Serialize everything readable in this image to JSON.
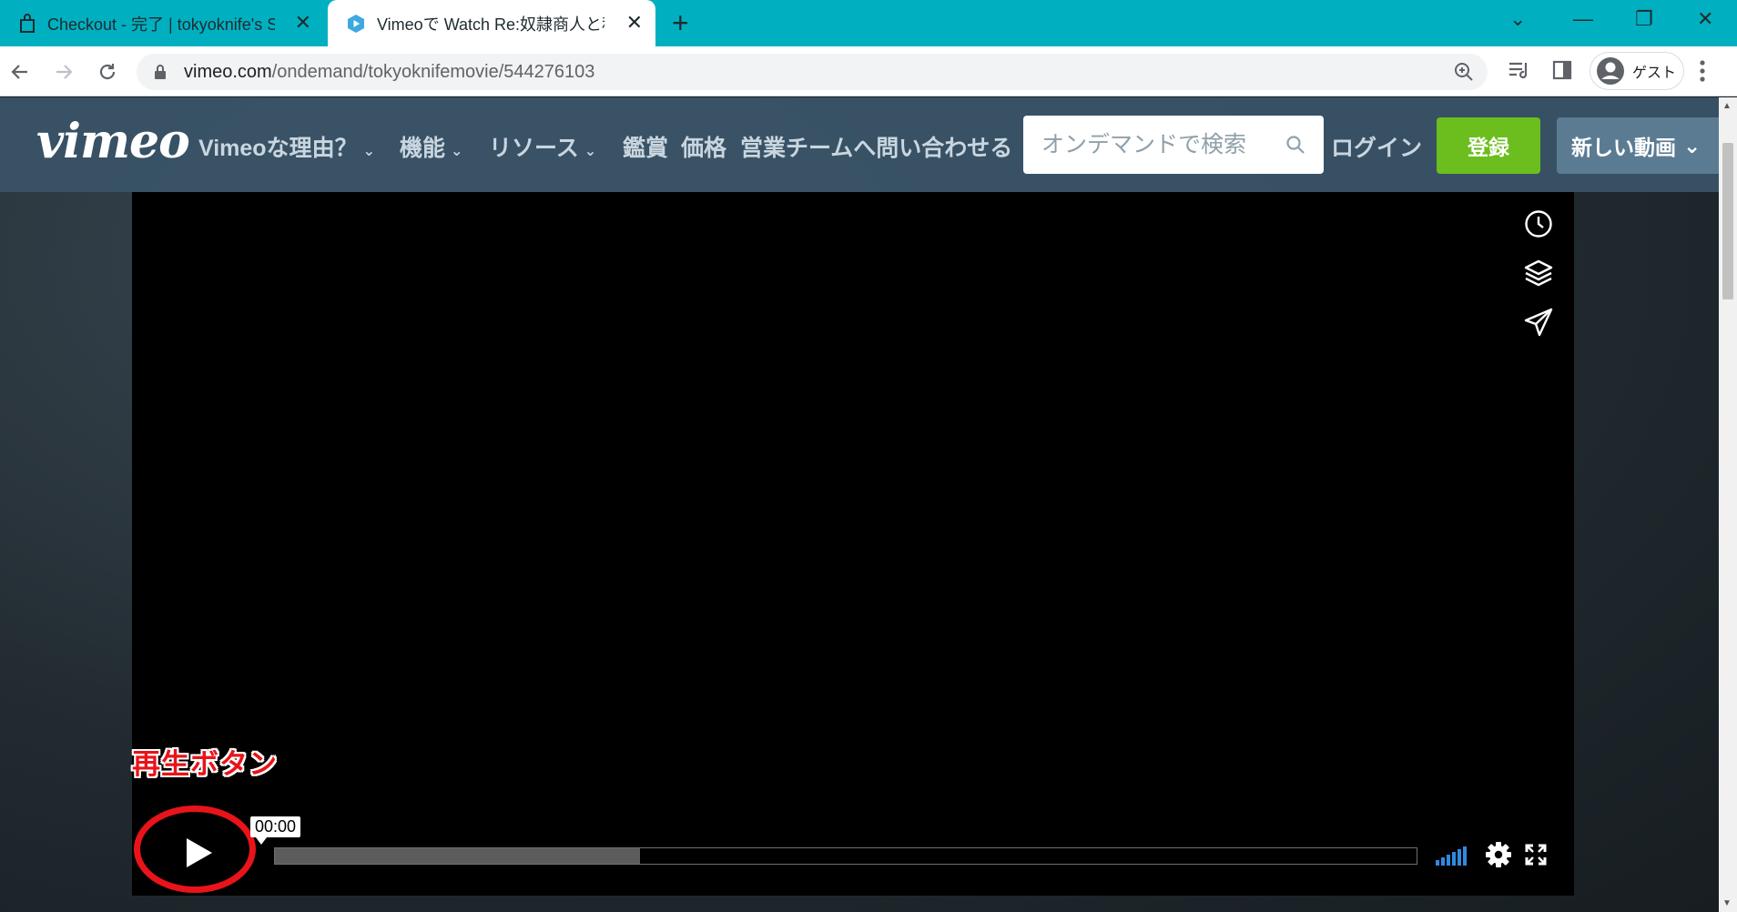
{
  "browser": {
    "tabs": [
      {
        "title": "Checkout - 完了 | tokyoknife's ST",
        "active": false
      },
      {
        "title": "Vimeoで Watch Re:奴隷商人と私 (",
        "active": true
      }
    ],
    "close_glyph": "✕",
    "new_tab_glyph": "+",
    "window_controls": [
      "⌄",
      "—",
      "❐",
      "✕"
    ],
    "url_host": "vimeo.com",
    "url_path": "/ondemand/tokyoknifemovie/544276103",
    "profile_label": "ゲスト"
  },
  "vimeo": {
    "logo": "vimeo",
    "nav": [
      {
        "label": "Vimeoな理由？",
        "dropdown": true
      },
      {
        "label": "機能",
        "dropdown": true
      },
      {
        "label": "リソース",
        "dropdown": true
      },
      {
        "label": "鑑賞",
        "dropdown": false
      },
      {
        "label": "価格",
        "dropdown": false
      },
      {
        "label": "営業チームへ問い合わせる",
        "dropdown": false
      }
    ],
    "chevron": "⌄",
    "search_placeholder": "オンデマンドで検索",
    "login": "ログイン",
    "signup": "登録",
    "new_video": "新しい動画",
    "new_video_chevron": "⌄",
    "accent_color": "#6bbe1d"
  },
  "player": {
    "annotation": "再生ボタン",
    "time": "00:00",
    "buffered_fraction": 0.32,
    "side_icons": [
      "clock-icon",
      "layers-icon",
      "send-icon"
    ],
    "volume_bars": 6
  }
}
